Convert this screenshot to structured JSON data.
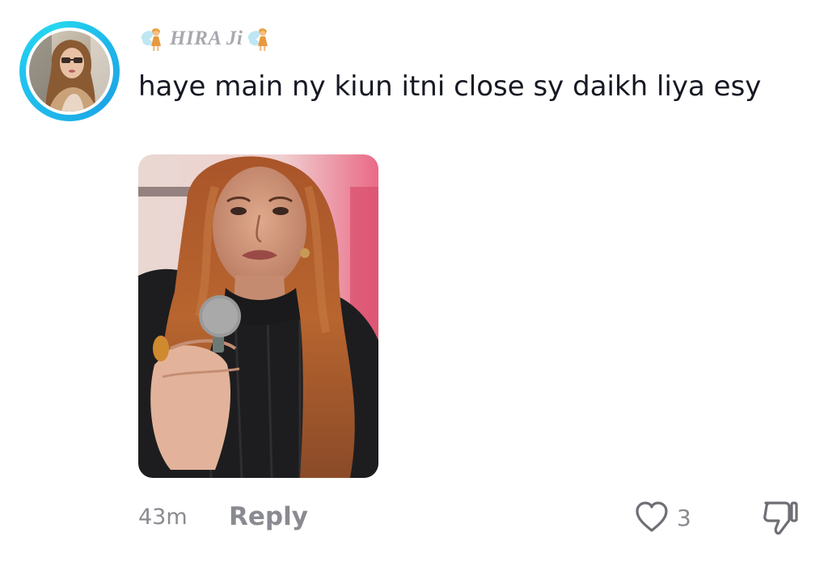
{
  "comment": {
    "username": "HIRA Ji",
    "username_decoration_icon": "fairy-emoji",
    "text": "haye main ny kiun itni close sy daikh liya esy",
    "has_media": true,
    "avatar_ring_color": "#1fb6ea"
  },
  "footer": {
    "timestamp": "43m",
    "reply_label": "Reply",
    "like_icon": "heart-outline-icon",
    "like_count": "3",
    "dislike_icon": "thumbs-down-icon"
  },
  "colors": {
    "text_primary": "#161823",
    "text_secondary": "#8a8b91",
    "username": "#a8a8ae"
  }
}
